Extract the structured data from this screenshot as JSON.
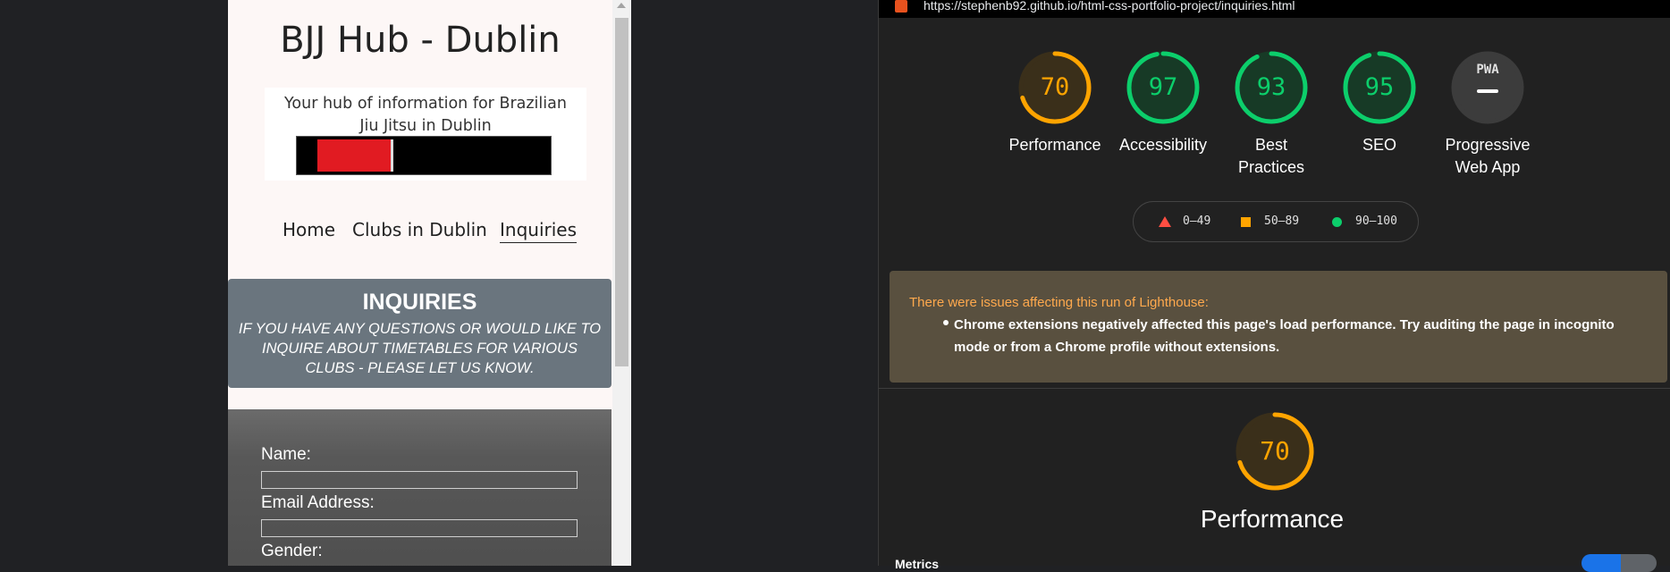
{
  "site": {
    "title": "BJJ Hub - Dublin",
    "tagline": "Your hub of information for Brazilian Jiu Jitsu in Dublin",
    "nav": [
      "Home",
      "Clubs in Dublin",
      "Inquiries"
    ],
    "active_nav": "Inquiries",
    "banner_title": "INQUIRIES",
    "banner_subtitle": "IF YOU HAVE ANY QUESTIONS OR WOULD LIKE TO INQUIRE ABOUT TIMETABLES FOR VARIOUS CLUBS - PLEASE LET US KNOW.",
    "form": {
      "name_label": "Name:",
      "email_label": "Email Address:",
      "gender_label": "Gender:"
    }
  },
  "lighthouse": {
    "url": "https://stephenb92.github.io/html-css-portfolio-project/inquiries.html",
    "scores": [
      {
        "label": "Performance",
        "value": "70",
        "score": 0.7,
        "color": "#ffa400"
      },
      {
        "label": "Accessibility",
        "value": "97",
        "score": 0.97,
        "color": "#0cce6b"
      },
      {
        "label": "Best Practices",
        "value": "93",
        "score": 0.93,
        "color": "#0cce6b"
      },
      {
        "label": "SEO",
        "value": "95",
        "score": 0.95,
        "color": "#0cce6b"
      },
      {
        "label": "Progressive Web App",
        "value": "PWA",
        "score": null,
        "color": "#9e9e9e"
      }
    ],
    "legend": [
      {
        "range": "0–49",
        "shape": "triangle",
        "color": "#ff4e42"
      },
      {
        "range": "50–89",
        "shape": "square",
        "color": "#ffa400"
      },
      {
        "range": "90–100",
        "shape": "circle",
        "color": "#0cce6b"
      }
    ],
    "warning_title": "There were issues affecting this run of Lighthouse:",
    "warning_item": "Chrome extensions negatively affected this page's load performance. Try auditing the page in incognito mode or from a Chrome profile without extensions.",
    "section_score": "70",
    "section_score_fraction": 0.7,
    "section_title": "Performance",
    "metrics_label": "Metrics"
  }
}
